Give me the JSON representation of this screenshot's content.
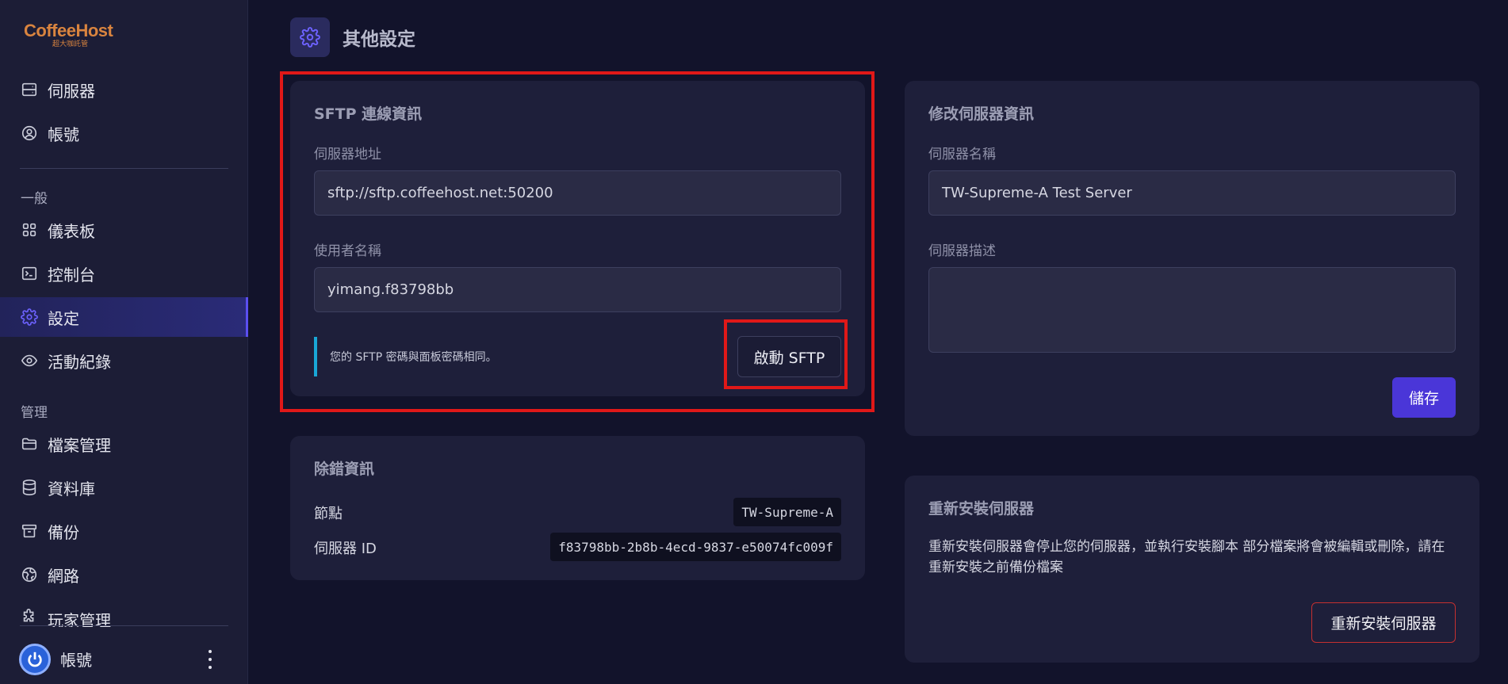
{
  "brand": {
    "logo_coffee": "Coffee",
    "logo_host": "Host",
    "logo_sub": "超大咖託管"
  },
  "sidebar": {
    "top_items": [
      {
        "label": "伺服器",
        "icon": "server-icon"
      },
      {
        "label": "帳號",
        "icon": "user-circle-icon"
      }
    ],
    "section_general": "一般",
    "general_items": [
      {
        "label": "儀表板",
        "icon": "grid-icon"
      },
      {
        "label": "控制台",
        "icon": "terminal-icon"
      },
      {
        "label": "設定",
        "icon": "gear-icon"
      },
      {
        "label": "活動紀錄",
        "icon": "eye-icon"
      }
    ],
    "section_manage": "管理",
    "manage_items": [
      {
        "label": "檔案管理",
        "icon": "folder-icon"
      },
      {
        "label": "資料庫",
        "icon": "database-icon"
      },
      {
        "label": "備份",
        "icon": "archive-icon"
      },
      {
        "label": "網路",
        "icon": "globe-icon"
      },
      {
        "label": "玩家管理",
        "icon": "puzzle-icon"
      }
    ],
    "account_label": "帳號",
    "active_item": "設定"
  },
  "header": {
    "title": "其他設定"
  },
  "sftp_card": {
    "title": "SFTP 連線資訊",
    "address_label": "伺服器地址",
    "address_value": "sftp://sftp.coffeehost.net:50200",
    "username_label": "使用者名稱",
    "username_value": "yimang.f83798bb",
    "note": "您的 SFTP 密碼與面板密碼相同。",
    "launch_button": "啟動 SFTP"
  },
  "debug_card": {
    "title": "除錯資訊",
    "node_label": "節點",
    "node_value": "TW-Supreme-A",
    "server_id_label": "伺服器 ID",
    "server_id_value": "f83798bb-2b8b-4ecd-9837-e50074fc009f"
  },
  "edit_card": {
    "title": "修改伺服器資訊",
    "name_label": "伺服器名稱",
    "name_value": "TW-Supreme-A Test Server",
    "desc_label": "伺服器描述",
    "desc_value": "",
    "save_button": "儲存"
  },
  "reinstall_card": {
    "title": "重新安裝伺服器",
    "description": "重新安裝伺服器會停止您的伺服器，並執行安裝腳本 部分檔案將會被編輯或刪除，請在重新安裝之前備份檔案",
    "button": "重新安裝伺服器"
  },
  "colors": {
    "accent": "#5b4ff0",
    "primary_button": "#4a36d8",
    "highlight_box": "#e01818",
    "note_bar": "#19a7d6",
    "danger_border": "#c53030"
  }
}
